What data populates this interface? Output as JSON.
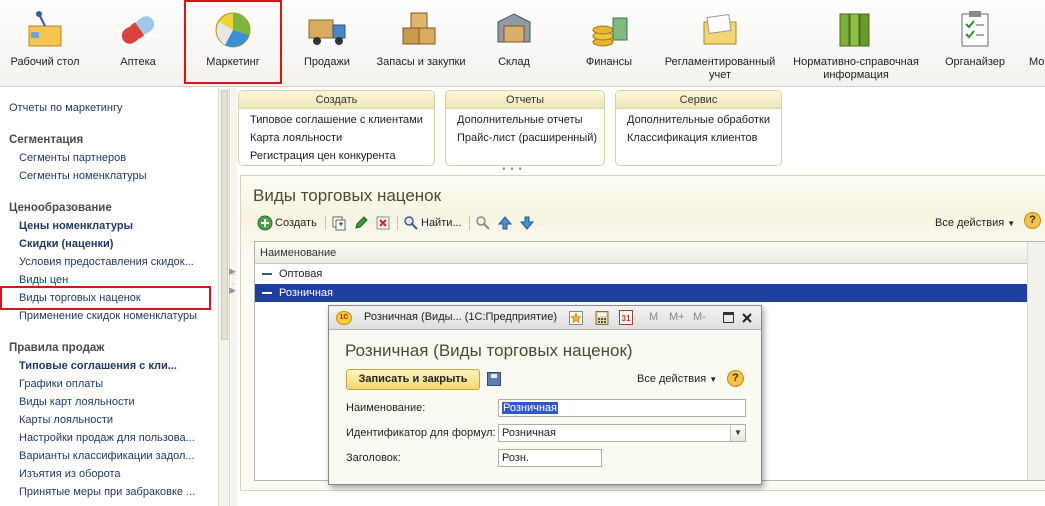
{
  "sections": [
    {
      "label": "Рабочий стол",
      "icon": "desk-icon"
    },
    {
      "label": "Аптека",
      "icon": "pill-icon"
    },
    {
      "label": "Маркетинг",
      "icon": "pie-chart-icon"
    },
    {
      "label": "Продажи",
      "icon": "truck-icon"
    },
    {
      "label": "Запасы и закупки",
      "icon": "boxes-icon"
    },
    {
      "label": "Склад",
      "icon": "warehouse-box-icon"
    },
    {
      "label": "Финансы",
      "icon": "coins-icon"
    },
    {
      "label": "Регламентированный учет",
      "icon": "folder-papers-icon"
    },
    {
      "label": "Нормативно-справочная информация",
      "icon": "binders-icon"
    },
    {
      "label": "Органайзер",
      "icon": "clipboard-icon"
    },
    {
      "label": "Мо",
      "icon": ""
    }
  ],
  "nav": {
    "top": "Отчеты по маркетингу",
    "g1": "Сегментация",
    "g1_items": [
      "Сегменты партнеров",
      "Сегменты номенклатуры"
    ],
    "g2": "Ценообразование",
    "g2_items": [
      "Цены номенклатуры",
      "Скидки (наценки)",
      "Условия предоставления скидок...",
      "Виды цен",
      "Виды торговых наценок",
      "Применение скидок номенклатуры"
    ],
    "g3": "Правила продаж",
    "g3_items": [
      "Типовые соглашения с кли...",
      "Графики оплаты",
      "Виды карт лояльности",
      "Карты лояльности",
      "Настройки продаж для пользова...",
      "Варианты классификации задол...",
      "Изъятия из оборота",
      "Принятые меры при забраковке ..."
    ]
  },
  "commands": {
    "create": {
      "title": "Создать",
      "items": [
        "Типовое соглашение с клиентами",
        "Карта лояльности",
        "Регистрация цен конкурента"
      ]
    },
    "reports": {
      "title": "Отчеты",
      "items": [
        "Дополнительные отчеты",
        "Прайс-лист (расширенный)"
      ]
    },
    "service": {
      "title": "Сервис",
      "items": [
        "Дополнительные обработки",
        "Классификация клиентов"
      ]
    }
  },
  "list": {
    "title": "Виды торговых наценок",
    "create_label": "Создать",
    "find_label": "Найти...",
    "all_actions": "Все действия",
    "column_name": "Наименование",
    "rows": [
      "Оптовая",
      "Розничная"
    ],
    "selected_index": 1
  },
  "popup": {
    "window_title": "Розничная (Виды... (1С:Предприятие)",
    "logo_text": "1С",
    "calendar_text": "31",
    "mem_buttons": [
      "M",
      "M+",
      "M-"
    ],
    "heading": "Розничная (Виды торговых наценок)",
    "save_close": "Записать и закрыть",
    "all_actions": "Все действия",
    "fields": [
      {
        "label": "Наименование:",
        "value": "Розничная"
      },
      {
        "label": "Идентификатор для формул:",
        "value": "Розничная"
      },
      {
        "label": "Заголовок:",
        "value": "Розн."
      }
    ]
  },
  "colors": {
    "accent_red": "#d6141b",
    "selection_blue": "#1e3f9e",
    "command_header": "#efe6b7"
  }
}
